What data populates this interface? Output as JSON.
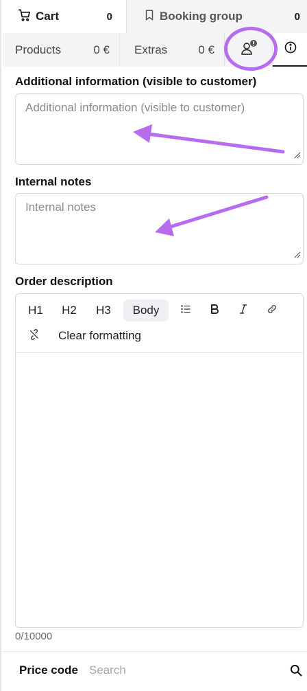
{
  "top_tabs": {
    "cart": {
      "label": "Cart",
      "count": "0"
    },
    "booking_group": {
      "label": "Booking group",
      "count": "0"
    }
  },
  "sub_tabs": {
    "products": {
      "label": "Products",
      "amount": "0 €"
    },
    "extras": {
      "label": "Extras",
      "amount": "0 €"
    },
    "customer_icon": "user-alert-icon",
    "info_icon": "info-icon"
  },
  "form": {
    "additional_info": {
      "label": "Additional information (visible to customer)",
      "placeholder": "Additional information (visible to customer)",
      "value": ""
    },
    "internal_notes": {
      "label": "Internal notes",
      "placeholder": "Internal notes",
      "value": ""
    },
    "order_description": {
      "label": "Order description",
      "toolbar": {
        "h1": "H1",
        "h2": "H2",
        "h3": "H3",
        "body": "Body",
        "clear_formatting": "Clear formatting"
      },
      "char_count": "0/10000"
    }
  },
  "price_code": {
    "label": "Price code",
    "placeholder": "Search"
  },
  "colors": {
    "annotation": "#b76cf0",
    "inactive_tab_bg": "#f3f4f6",
    "border": "#e6e6e6"
  }
}
